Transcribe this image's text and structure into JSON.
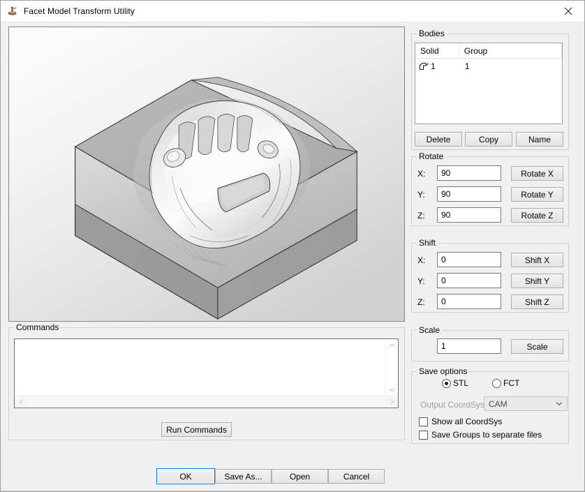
{
  "window": {
    "title": "Facet Model Transform Utility",
    "icon": "app-icon",
    "close_label": "✕"
  },
  "viewport": {
    "name": "3d-model-view",
    "model_description": "Shaded gray facet model of a machined block with a car body cavity"
  },
  "bodies": {
    "title": "Bodies",
    "columns": [
      "Solid",
      "Group"
    ],
    "rows": [
      {
        "solid": "1",
        "group": "1"
      }
    ],
    "buttons": [
      {
        "label": "Delete",
        "name": "delete-button"
      },
      {
        "label": "Copy",
        "name": "copy-button"
      },
      {
        "label": "Name",
        "name": "name-button"
      }
    ]
  },
  "rotate": {
    "title": "Rotate",
    "fields": [
      {
        "label": "X:",
        "value": "90",
        "button": "Rotate X"
      },
      {
        "label": "Y:",
        "value": "90",
        "button": "Rotate Y"
      },
      {
        "label": "Z:",
        "value": "90",
        "button": "Rotate Z"
      }
    ]
  },
  "shift": {
    "title": "Shift",
    "fields": [
      {
        "label": "X:",
        "value": "0",
        "button": "Shift X"
      },
      {
        "label": "Y:",
        "value": "0",
        "button": "Shift Y"
      },
      {
        "label": "Z:",
        "value": "0",
        "button": "Shift Z"
      }
    ]
  },
  "scale": {
    "title": "Scale",
    "value": "1",
    "button": "Scale"
  },
  "save_options": {
    "title": "Save options",
    "format_selected": "STL",
    "formats": [
      {
        "label": "STL",
        "selected": true
      },
      {
        "label": "FCT",
        "selected": false
      }
    ],
    "coordsys_label": "Output CoordSys:",
    "coordsys_value": "CAM",
    "coordsys_enabled": false,
    "checkboxes": [
      {
        "label": "Show all CoordSys",
        "checked": false
      },
      {
        "label": "Save Groups to separate files",
        "checked": false
      }
    ]
  },
  "commands": {
    "title": "Commands",
    "text": "",
    "placeholder": "",
    "run_button": "Run Commands"
  },
  "dialog_buttons": [
    {
      "label": "OK",
      "name": "ok-button",
      "default": true
    },
    {
      "label": "Save As...",
      "name": "save-as-button",
      "default": false
    },
    {
      "label": "Open",
      "name": "open-button",
      "default": false
    },
    {
      "label": "Cancel",
      "name": "cancel-button",
      "default": false
    }
  ],
  "colors": {
    "dialog_background": "#f0f0f0",
    "titlebar_background": "#ffffff",
    "accent_focus": "#0078d7",
    "field_background": "#ffffff",
    "groupbox_border": "#d4d0c8",
    "disabled_text": "#9d9d9d"
  }
}
